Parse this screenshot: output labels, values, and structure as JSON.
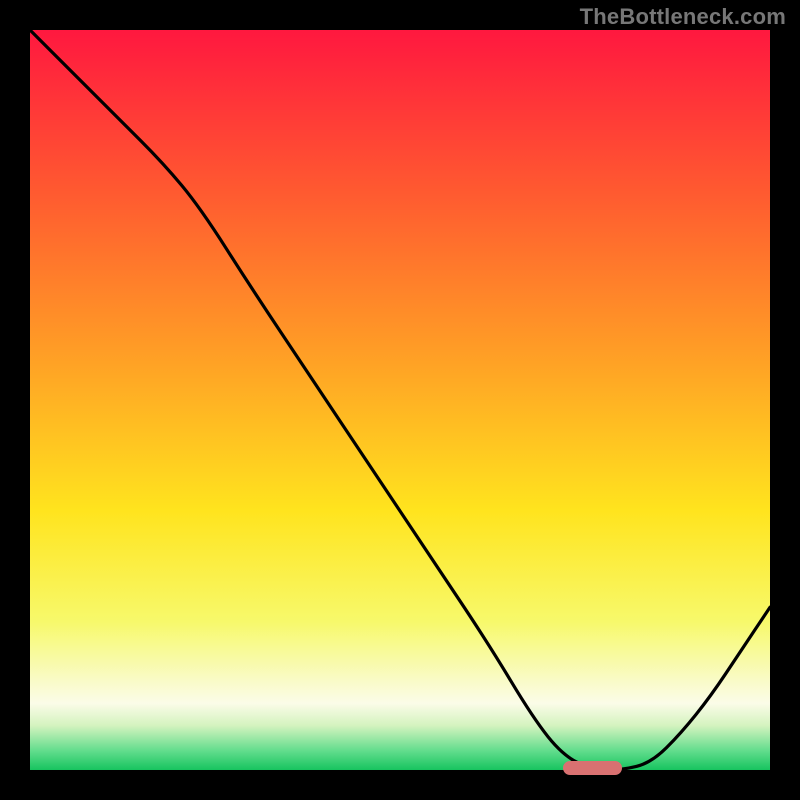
{
  "watermark": "TheBottleneck.com",
  "colors": {
    "gradient_stops": [
      {
        "offset": 0.0,
        "color": "#ff183f"
      },
      {
        "offset": 0.22,
        "color": "#ff5a30"
      },
      {
        "offset": 0.45,
        "color": "#ffa225"
      },
      {
        "offset": 0.65,
        "color": "#ffe41e"
      },
      {
        "offset": 0.8,
        "color": "#f7f96b"
      },
      {
        "offset": 0.88,
        "color": "#f9fbc8"
      },
      {
        "offset": 0.91,
        "color": "#fbfce8"
      },
      {
        "offset": 0.94,
        "color": "#d4f3bf"
      },
      {
        "offset": 0.975,
        "color": "#5fdc8b"
      },
      {
        "offset": 1.0,
        "color": "#17c45f"
      }
    ],
    "curve": "#000000",
    "marker": "#d97171",
    "background": "#000000"
  },
  "chart_data": {
    "type": "line",
    "title": "",
    "xlabel": "",
    "ylabel": "",
    "xlim": [
      0,
      100
    ],
    "ylim": [
      0,
      100
    ],
    "grid": false,
    "series": [
      {
        "name": "curve",
        "x": [
          0,
          6,
          12,
          18,
          23,
          30,
          38,
          46,
          54,
          62,
          68,
          72,
          76,
          80,
          84,
          88,
          92,
          96,
          100
        ],
        "y": [
          100,
          94,
          88,
          82,
          76,
          65,
          53,
          41,
          29,
          17,
          7,
          2,
          0,
          0,
          1,
          5,
          10,
          16,
          22
        ]
      }
    ],
    "optimal_marker": {
      "x_start": 72,
      "x_end": 80,
      "y": 0
    }
  }
}
